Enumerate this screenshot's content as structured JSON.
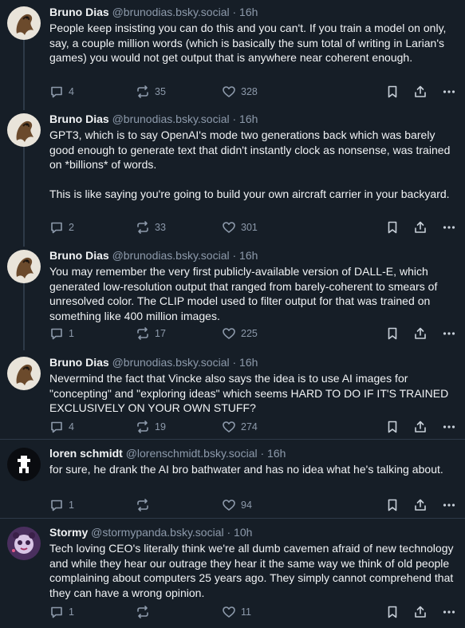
{
  "posts": [
    {
      "author": "Bruno Dias",
      "handle": "@brunodias.bsky.social",
      "time": "· 16h",
      "text": "People keep insisting you can do this and you can't. If you train a model on only, say, a couple million words (which is basically the sum total of writing in Larian's games) you would not get output that is anywhere near coherent enough.",
      "replies": "4",
      "reposts": "35",
      "likes": "328"
    },
    {
      "author": "Bruno Dias",
      "handle": "@brunodias.bsky.social",
      "time": "· 16h",
      "text": "GPT3, which is to say OpenAI's mode two generations back which was barely good enough to generate text that didn't instantly clock as nonsense, was trained on *billions* of words.\n\nThis is like saying you're going to build your own aircraft carrier in your backyard.",
      "replies": "2",
      "reposts": "33",
      "likes": "301"
    },
    {
      "author": "Bruno Dias",
      "handle": "@brunodias.bsky.social",
      "time": "· 16h",
      "text": "You may remember the very first publicly-available version of DALL-E, which generated low-resolution output that ranged from barely-coherent to smears of unresolved color. The CLIP model used to filter output for that was trained on something like 400 million images.",
      "replies": "1",
      "reposts": "17",
      "likes": "225"
    },
    {
      "author": "Bruno Dias",
      "handle": "@brunodias.bsky.social",
      "time": "· 16h",
      "text": "Nevermind the fact that Vincke also says the idea is to use AI images for \"concepting\" and \"exploring ideas\" which seems HARD TO DO IF IT'S TRAINED EXCLUSIVELY ON YOUR OWN STUFF?",
      "replies": "4",
      "reposts": "19",
      "likes": "274"
    },
    {
      "author": "loren schmidt",
      "handle": "@lorenschmidt.bsky.social",
      "time": "· 16h",
      "text": "for sure, he drank the AI bro bathwater and has no idea what he's talking about.",
      "replies": "1",
      "reposts": "",
      "likes": "94"
    },
    {
      "author": "Stormy",
      "handle": "@stormypanda.bsky.social",
      "time": "· 10h",
      "text": "Tech loving CEO's literally think we're all dumb cavemen afraid of new technology and while they hear our outrage they hear it the same way we think of old people complaining about computers 25 years ago. They simply cannot comprehend that they can have a wrong opinion.",
      "replies": "1",
      "reposts": "",
      "likes": "11"
    }
  ],
  "icons": {
    "reply": "speech-bubble-icon",
    "repost": "repost-arrows-icon",
    "like": "heart-icon",
    "save": "bookmark-icon",
    "share": "share-icon",
    "more": "ellipsis-icon"
  },
  "colors": {
    "background": "#161e27",
    "text": "#f1f3f5",
    "muted": "#8d9aab",
    "thread_line": "#2e3a48"
  }
}
